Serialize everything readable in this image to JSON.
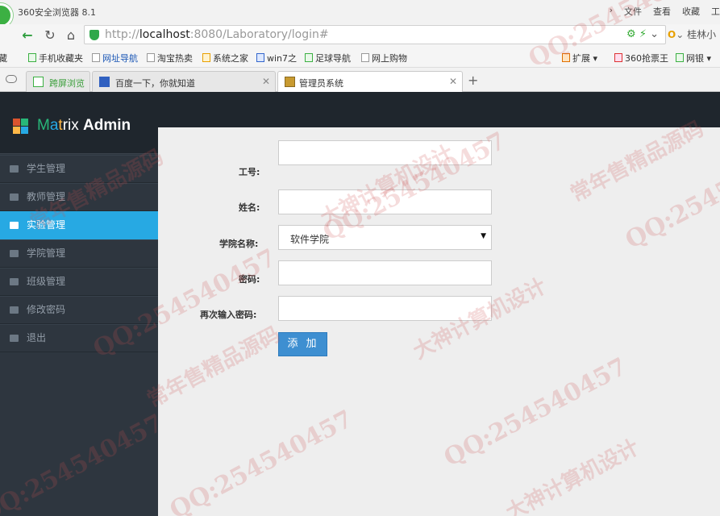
{
  "browser": {
    "title": "360安全浏览器 8.1",
    "menu": [
      "文件",
      "查看",
      "收藏",
      "工"
    ],
    "address": {
      "prefix": "http://",
      "host": "localhost",
      "rest": ":8080/Laboratory/login#"
    },
    "search_hint": "桂林小",
    "favorites": [
      "藏",
      "手机收藏夹",
      "网址导航",
      "淘宝热卖",
      "系统之家",
      "win7之",
      "足球导航",
      "网上购物",
      "扩展",
      "360抢票王",
      "网银"
    ],
    "tabs": [
      {
        "label": "跨屏浏览",
        "icon": "phone-icon"
      },
      {
        "label": "百度一下，你就知道",
        "icon": "baidu-paw-icon"
      },
      {
        "label": "管理员系统",
        "icon": "page-icon"
      }
    ]
  },
  "app": {
    "brand": {
      "m": "M",
      "a": "a",
      "t": "t",
      "rix": "rix",
      "admin": "Admin"
    },
    "menu": [
      {
        "label": "学生管理",
        "icon": "picture-icon",
        "active": false
      },
      {
        "label": "教师管理",
        "icon": "users-icon",
        "active": false
      },
      {
        "label": "实验管理",
        "icon": "flag-icon",
        "active": true
      },
      {
        "label": "学院管理",
        "icon": "tag-icon",
        "active": false
      },
      {
        "label": "班级管理",
        "icon": "user-icon",
        "active": false
      },
      {
        "label": "修改密码",
        "icon": "key-icon",
        "active": false
      },
      {
        "label": "退出",
        "icon": "logout-icon",
        "active": false
      }
    ],
    "colors": {
      "active": "#27a9e3",
      "sidebar": "#2e363f",
      "topbar": "#1f262d",
      "button": "#3e8fd1"
    },
    "form": {
      "employee_id_label": "工号:",
      "name_label": "姓名:",
      "college_label": "学院名称:",
      "college_value": "软件学院",
      "password_label": "密码:",
      "confirm_password_label": "再次输入密码:",
      "submit_label": "添加"
    }
  },
  "watermarks": {
    "qq": "QQ:254540457",
    "text1": "大神计算机设计",
    "text2": "常年售精品源码"
  }
}
